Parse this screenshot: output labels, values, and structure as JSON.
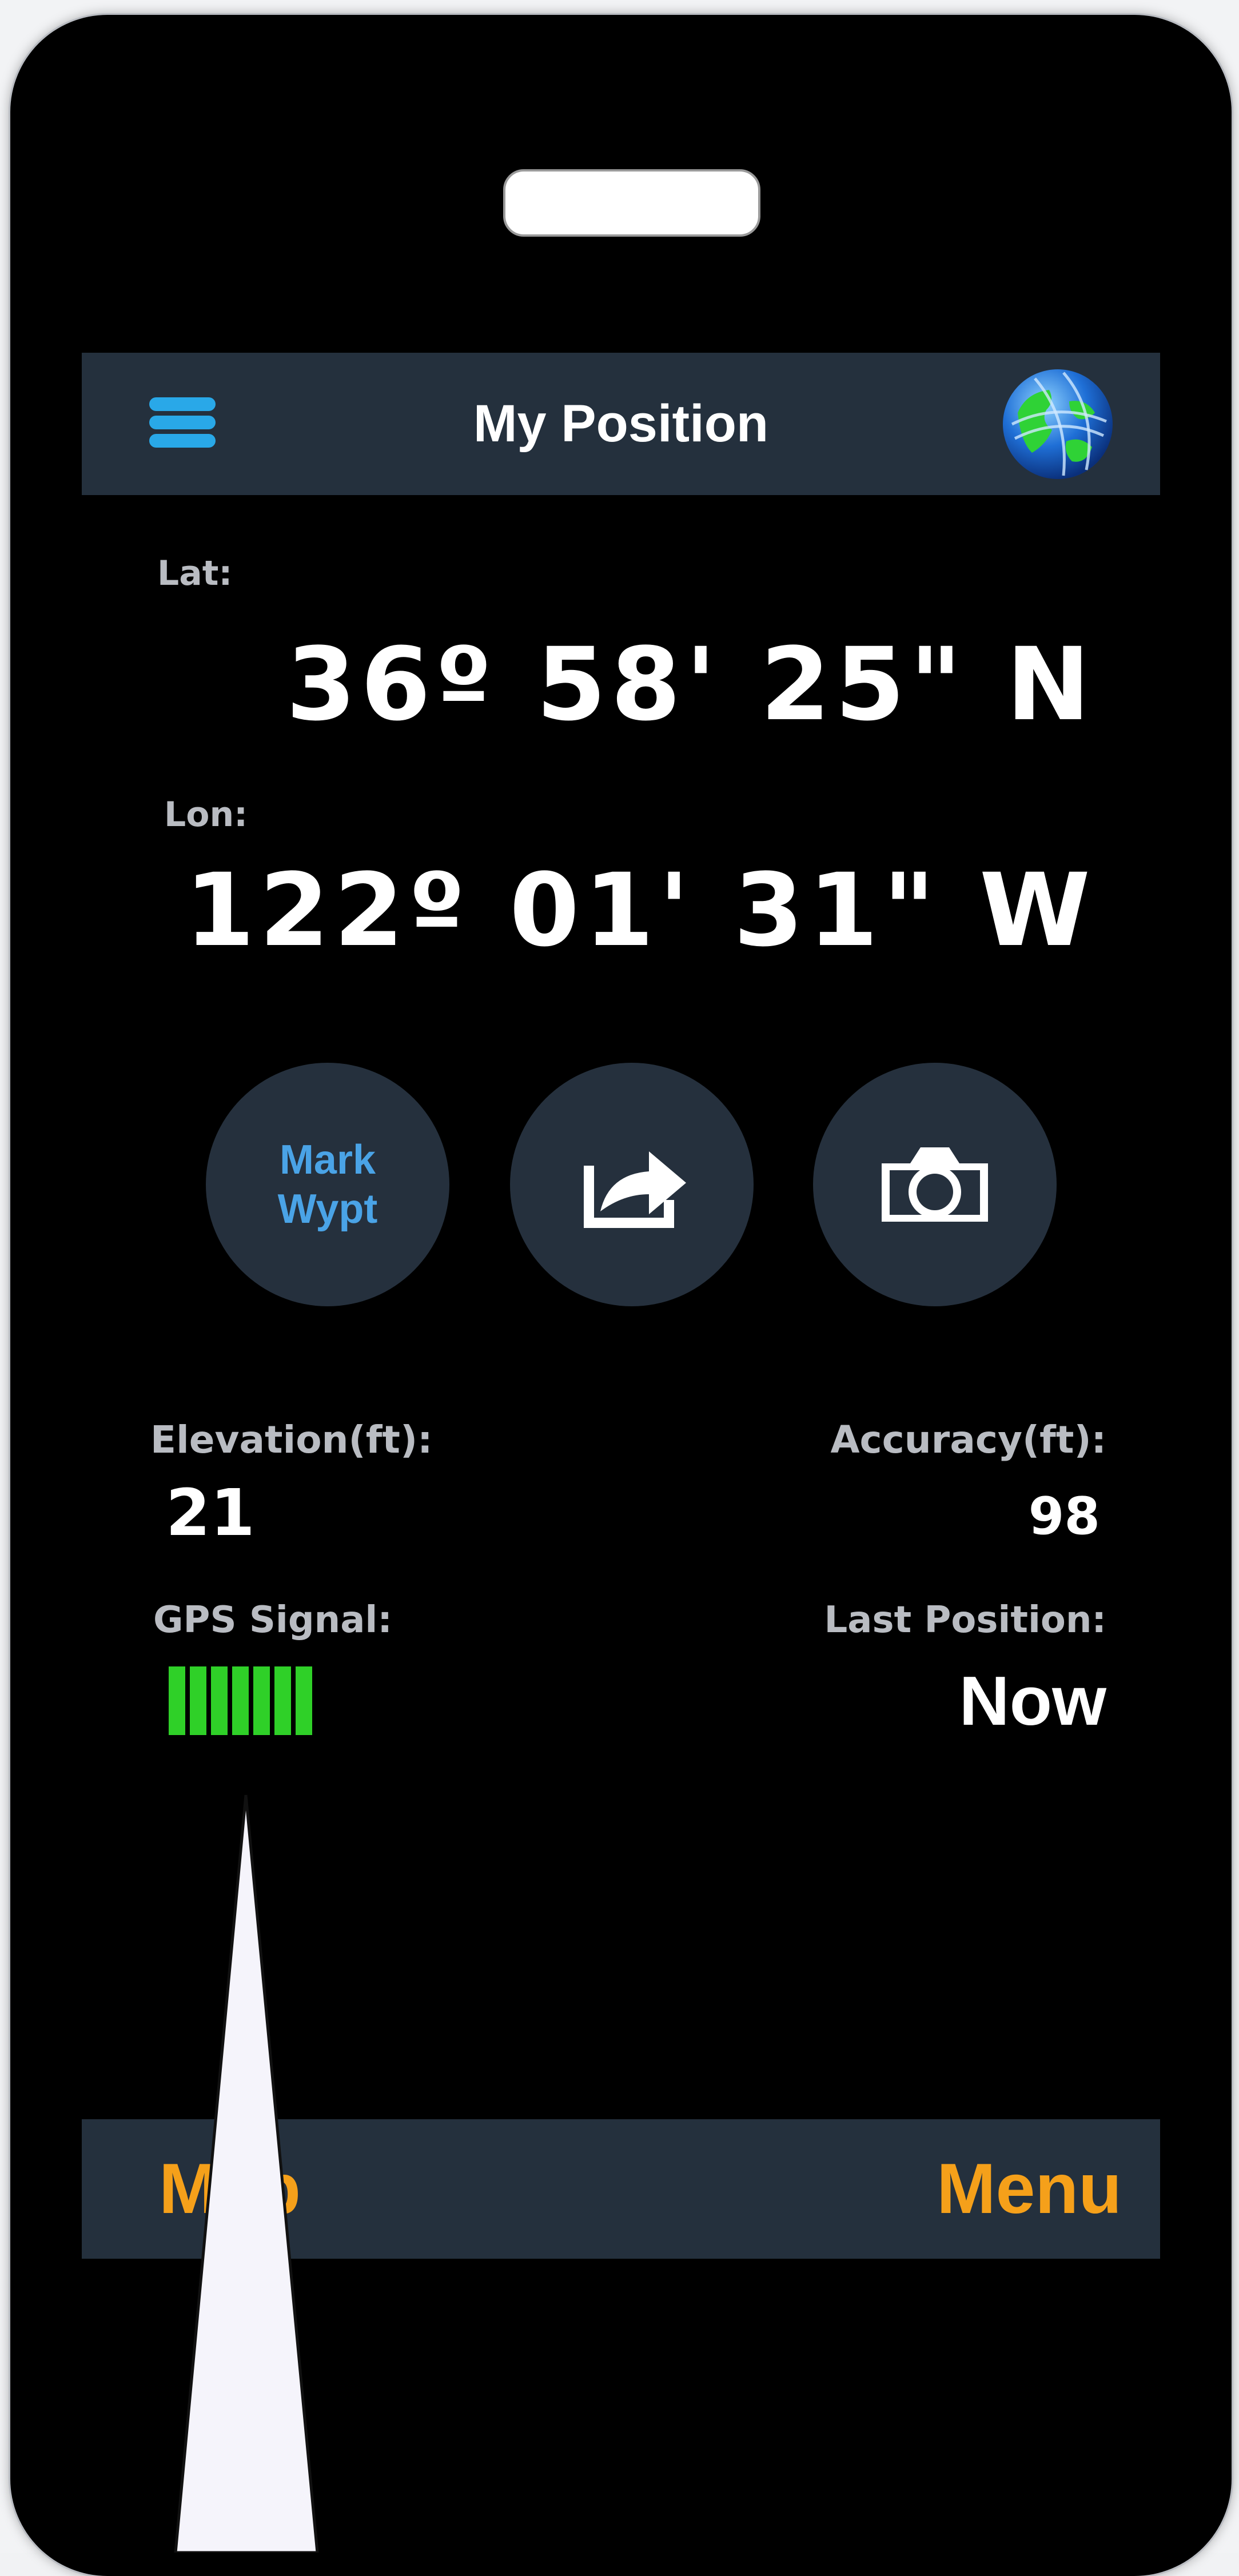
{
  "header": {
    "title": "My Position",
    "menu_icon": "hamburger-menu-icon",
    "globe_icon": "globe-icon"
  },
  "position": {
    "lat_label": "Lat:",
    "lat_value": "36º 58' 25\" N",
    "lon_label": "Lon:",
    "lon_value": "122º 01' 31\" W"
  },
  "actions": {
    "mark_line1": "Mark",
    "mark_line2": "Wypt",
    "share_icon": "share-arrow-icon",
    "camera_icon": "camera-icon"
  },
  "stats": {
    "elevation_label": "Elevation(ft):",
    "elevation_value": "21",
    "accuracy_label": "Accuracy(ft):",
    "accuracy_value": "98",
    "gps_label": "GPS Signal:",
    "gps_signal_bars": 7,
    "gps_signal_max": 7,
    "last_position_label": "Last Position:",
    "last_position_value": "Now"
  },
  "footer": {
    "map_label": "Map",
    "menu_label": "Menu"
  },
  "colors": {
    "bar_bg": "#24303d",
    "accent_blue": "#29a8e8",
    "footer_orange": "#f5a01a",
    "signal_green": "#2fd028"
  }
}
